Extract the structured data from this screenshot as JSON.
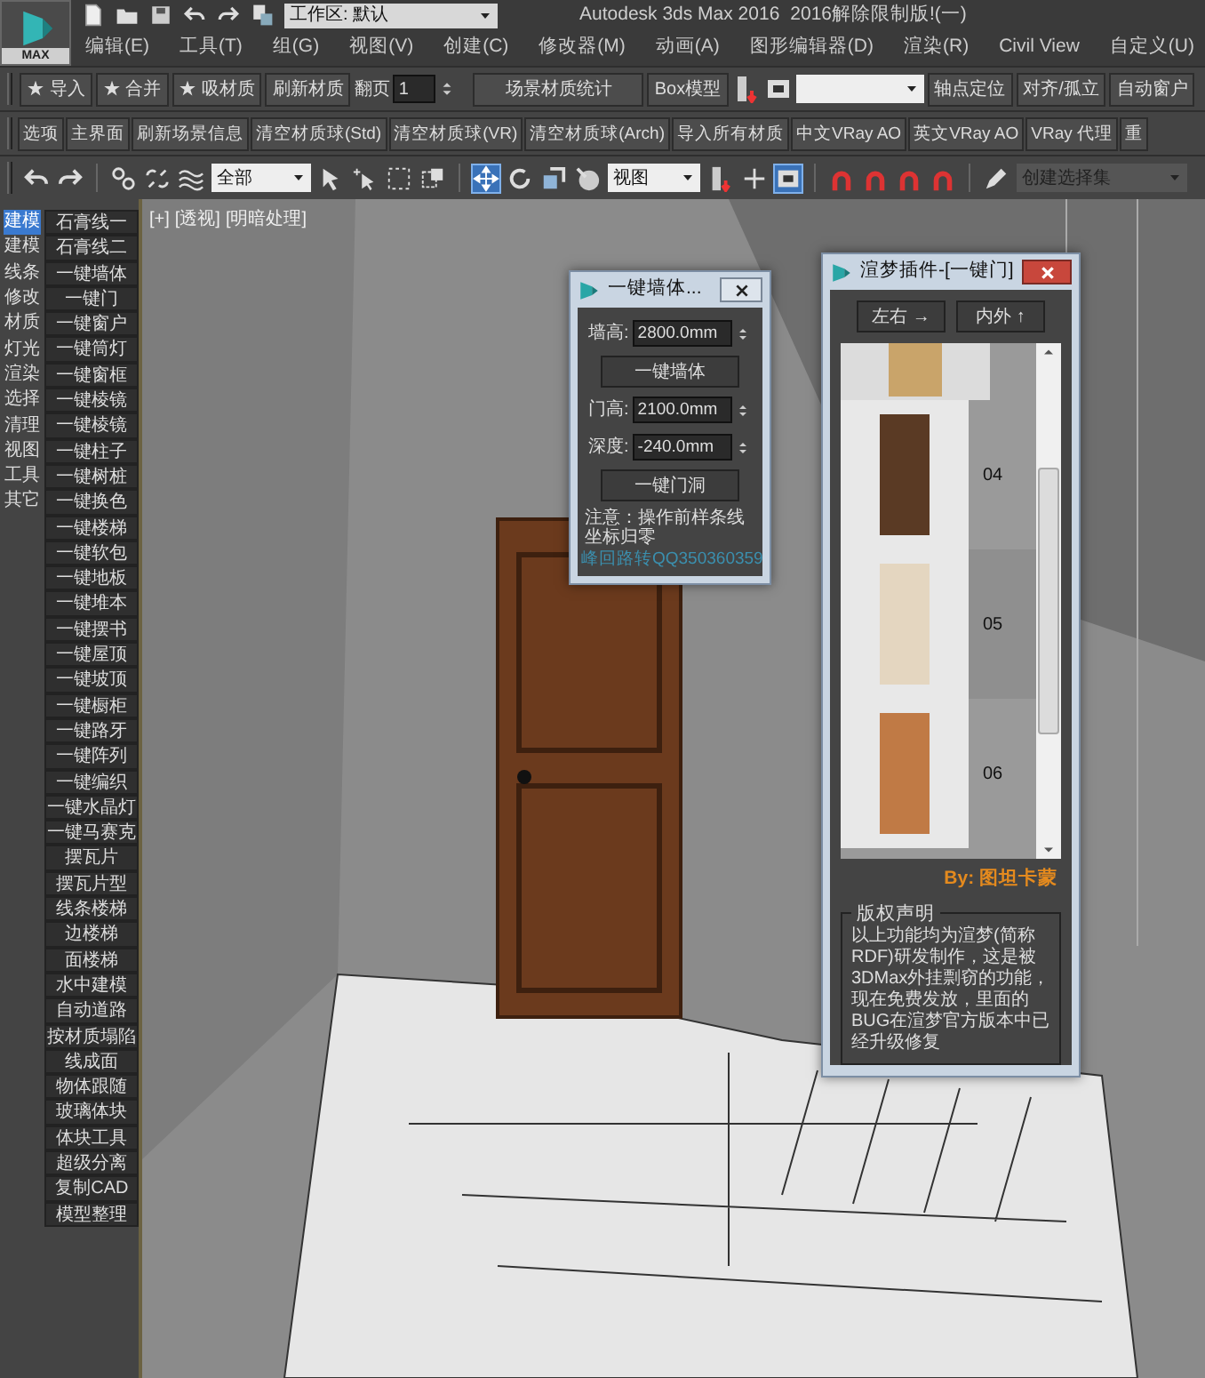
{
  "app": {
    "logo": "MAX",
    "workspace": "工作区: 默认",
    "title": "Autodesk 3ds Max 2016",
    "subtitle": "2016解除限制版!(一)"
  },
  "menu": [
    "编辑(E)",
    "工具(T)",
    "组(G)",
    "视图(V)",
    "创建(C)",
    "修改器(M)",
    "动画(A)",
    "图形编辑器(D)",
    "渲染(R)",
    "Civil View",
    "自定义(U)"
  ],
  "toolbar_1": {
    "left_buttons": [
      "★ 导入",
      "★ 合并",
      "★ 吸材质",
      "刷新材质"
    ],
    "page_spinner": {
      "label": "翻页",
      "value": "1"
    },
    "mid_buttons": [
      "场景材质统计",
      "Box模型"
    ],
    "right_buttons": [
      "轴点定位",
      "对齐/孤立",
      "自动窗户"
    ]
  },
  "toolbar_2": [
    "选项",
    "主界面",
    "刷新场景信息",
    "清空材质球(Std)",
    "清空材质球(VR)",
    "清空材质球(Arch)",
    "导入所有材质",
    "中文VRay AO",
    "英文VRay AO",
    "VRay 代理",
    "重"
  ],
  "toolbar_3": {
    "selection_filter": "全部",
    "move_selected": true,
    "reference_coord": "视图",
    "snap_toggle_selected": true,
    "named_selection": "创建选择集"
  },
  "sidebar": {
    "categories": [
      {
        "label": "建模",
        "selected": true
      },
      {
        "label": "建模",
        "selected": false
      },
      {
        "label": "线条",
        "selected": false
      },
      {
        "label": "修改",
        "selected": false
      },
      {
        "label": "材质",
        "selected": false
      },
      {
        "label": "灯光",
        "selected": false
      },
      {
        "label": "渲染",
        "selected": false
      },
      {
        "label": "选择",
        "selected": false
      },
      {
        "label": "清理",
        "selected": false
      },
      {
        "label": "视图",
        "selected": false
      },
      {
        "label": "工具",
        "selected": false
      },
      {
        "label": "其它",
        "selected": false
      }
    ],
    "tools": [
      "石膏线一",
      "石膏线二",
      "一键墙体",
      "一键门",
      "一键窗户",
      "一键筒灯",
      "一键窗框",
      "一键棱镜",
      "一键棱镜",
      "一键柱子",
      "一键树桩",
      "一键换色",
      "一键楼梯",
      "一键软包",
      "一键地板",
      "一键堆本",
      "一键摆书",
      "一键屋顶",
      "一键坡顶",
      "一键橱柜",
      "一键路牙",
      "一键阵列",
      "一键编织",
      "一键水晶灯",
      "一键马赛克",
      "摆瓦片",
      "摆瓦片型",
      "线条楼梯",
      "边楼梯",
      "面楼梯",
      "水中建模",
      "自动道路",
      "按材质塌陷",
      "线成面",
      "物体跟随",
      "玻璃体块",
      "体块工具",
      "超级分离",
      "复制CAD",
      "模型整理"
    ]
  },
  "viewport": {
    "labels": [
      "[+]",
      "[透视]",
      "[明暗处理]"
    ]
  },
  "wall_dialog": {
    "title": "一键墙体...",
    "rows": [
      {
        "kind": "spinner",
        "label": "墙高:",
        "value": "2800.0mm"
      },
      {
        "kind": "button",
        "label": "一键墙体"
      },
      {
        "kind": "spinner",
        "label": "门高:",
        "value": "2100.0mm"
      },
      {
        "kind": "spinner",
        "label": "深度:",
        "value": "-240.0mm"
      },
      {
        "kind": "button",
        "label": "一键门洞"
      }
    ],
    "note": "注意：操作前样条线坐标归零",
    "contact": "峰回路转QQ350360359"
  },
  "door_dialog": {
    "title": "渲梦插件-[一键门]",
    "buttons": [
      "左右 →",
      "内外 ↑"
    ],
    "doors": [
      {
        "label": "04"
      },
      {
        "label": "05"
      },
      {
        "label": "06"
      }
    ],
    "credit": "By: 图坦卡蒙",
    "notice_title": "版权声明",
    "notice": "以上功能均为渲梦(简称RDF)研发制作，这是被3DMax外挂剽窃的功能，现在免费发放，里面的BUG在渲梦官方版本中已经升级修复"
  }
}
